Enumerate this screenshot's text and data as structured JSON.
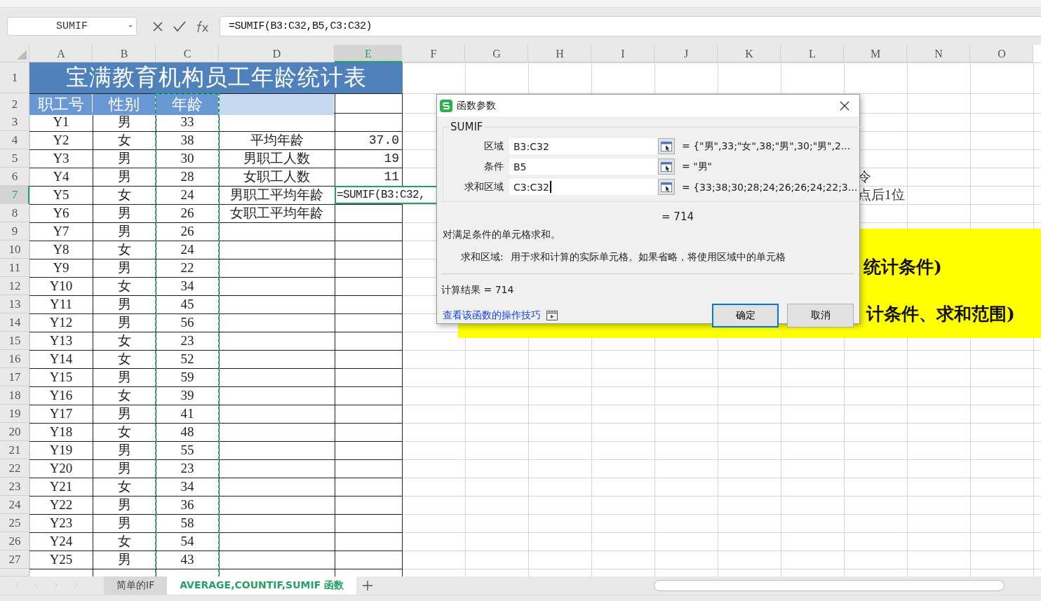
{
  "name_box": "SUMIF",
  "formula": "=SUMIF(B3:C32,B5,C3:C32)",
  "columns": [
    {
      "label": "A",
      "selected": false
    },
    {
      "label": "B",
      "selected": false
    },
    {
      "label": "C",
      "selected": false
    },
    {
      "label": "D",
      "selected": false
    },
    {
      "label": "E",
      "selected": true
    },
    {
      "label": "F",
      "selected": false
    },
    {
      "label": "G",
      "selected": false
    },
    {
      "label": "H",
      "selected": false
    },
    {
      "label": "I",
      "selected": false
    },
    {
      "label": "J",
      "selected": false
    },
    {
      "label": "K",
      "selected": false
    },
    {
      "label": "L",
      "selected": false
    },
    {
      "label": "M",
      "selected": false
    },
    {
      "label": "N",
      "selected": false
    },
    {
      "label": "O",
      "selected": false
    }
  ],
  "title": "宝满教育机构员工年龄统计表",
  "row_numbers": [
    {
      "label": "1",
      "selected": false
    },
    {
      "label": "2",
      "selected": false
    },
    {
      "label": "3",
      "selected": false
    },
    {
      "label": "4",
      "selected": false
    },
    {
      "label": "5",
      "selected": false
    },
    {
      "label": "6",
      "selected": false
    },
    {
      "label": "7",
      "selected": true
    },
    {
      "label": "8",
      "selected": false
    },
    {
      "label": "9",
      "selected": false
    },
    {
      "label": "10",
      "selected": false
    },
    {
      "label": "11",
      "selected": false
    },
    {
      "label": "12",
      "selected": false
    },
    {
      "label": "13",
      "selected": false
    },
    {
      "label": "14",
      "selected": false
    },
    {
      "label": "15",
      "selected": false
    },
    {
      "label": "16",
      "selected": false
    },
    {
      "label": "17",
      "selected": false
    },
    {
      "label": "18",
      "selected": false
    },
    {
      "label": "19",
      "selected": false
    },
    {
      "label": "20",
      "selected": false
    },
    {
      "label": "21",
      "selected": false
    },
    {
      "label": "22",
      "selected": false
    },
    {
      "label": "23",
      "selected": false
    },
    {
      "label": "24",
      "selected": false
    },
    {
      "label": "25",
      "selected": false
    },
    {
      "label": "26",
      "selected": false
    },
    {
      "label": "27",
      "selected": false
    }
  ],
  "headers": [
    "职工号",
    "性别",
    "年龄"
  ],
  "rows": [
    {
      "id": "Y1",
      "gender": "男",
      "age": "33"
    },
    {
      "id": "Y2",
      "gender": "女",
      "age": "38",
      "stat": {
        "label": "平均年龄",
        "value": "37.0",
        "selected": false
      }
    },
    {
      "id": "Y3",
      "gender": "男",
      "age": "30",
      "stat": {
        "label": "男职工人数",
        "value": "19",
        "selected": false
      }
    },
    {
      "id": "Y4",
      "gender": "男",
      "age": "28",
      "stat": {
        "label": "女职工人数",
        "value": "11",
        "selected": false
      },
      "note": "令"
    },
    {
      "id": "Y5",
      "gender": "女",
      "age": "24",
      "stat": {
        "label": "男职工平均年龄",
        "value": "=SUMIF(B3:C32,",
        "selected": true
      },
      "note": "点后1位"
    },
    {
      "id": "Y6",
      "gender": "男",
      "age": "26",
      "stat": {
        "label": "女职工平均年龄",
        "selected": false
      }
    },
    {
      "id": "Y7",
      "gender": "男",
      "age": "26"
    },
    {
      "id": "Y8",
      "gender": "女",
      "age": "24"
    },
    {
      "id": "Y9",
      "gender": "男",
      "age": "22"
    },
    {
      "id": "Y10",
      "gender": "女",
      "age": "34"
    },
    {
      "id": "Y11",
      "gender": "男",
      "age": "45"
    },
    {
      "id": "Y12",
      "gender": "男",
      "age": "56"
    },
    {
      "id": "Y13",
      "gender": "女",
      "age": "23"
    },
    {
      "id": "Y14",
      "gender": "女",
      "age": "52"
    },
    {
      "id": "Y15",
      "gender": "男",
      "age": "59"
    },
    {
      "id": "Y16",
      "gender": "女",
      "age": "39"
    },
    {
      "id": "Y17",
      "gender": "男",
      "age": "41"
    },
    {
      "id": "Y18",
      "gender": "女",
      "age": "48"
    },
    {
      "id": "Y19",
      "gender": "男",
      "age": "55"
    },
    {
      "id": "Y20",
      "gender": "男",
      "age": "23"
    },
    {
      "id": "Y21",
      "gender": "女",
      "age": "34"
    },
    {
      "id": "Y22",
      "gender": "男",
      "age": "36"
    },
    {
      "id": "Y23",
      "gender": "男",
      "age": "58"
    },
    {
      "id": "Y24",
      "gender": "女",
      "age": "54"
    },
    {
      "id": "Y25",
      "gender": "男",
      "age": "43"
    }
  ],
  "yellow_notes": [
    "统计条件)",
    "计条件、求和范围)"
  ],
  "dialog": {
    "title": "函数参数",
    "function": "SUMIF",
    "args": [
      {
        "label": "区域",
        "value": "B3:C32",
        "result": "= {\"男\",33;\"女\",38;\"男\",30;\"男\",2...",
        "focused": false
      },
      {
        "label": "条件",
        "value": "B5",
        "result": "= \"男\"",
        "focused": false
      },
      {
        "label": "求和区域",
        "value": "C3:C32",
        "result": "= {33;38;30;28;24;26;26;24;22;3...",
        "focused": true
      }
    ],
    "total": "= 714",
    "description": "对满足条件的单元格求和。",
    "arg_help": {
      "label": "求和区域:",
      "text": "用于求和计算的实际单元格。如果省略，将使用区域中的单元格"
    },
    "result": "计算结果 = 714",
    "link": "查看该函数的操作技巧",
    "buttons": [
      {
        "label": "确定",
        "default": true
      },
      {
        "label": "取消",
        "default": false
      }
    ]
  },
  "sheet_tabs": [
    {
      "label": "简单的IF",
      "selected": false
    },
    {
      "label": "AVERAGE,COUNTIF,SUMIF 函数",
      "selected": true
    }
  ]
}
